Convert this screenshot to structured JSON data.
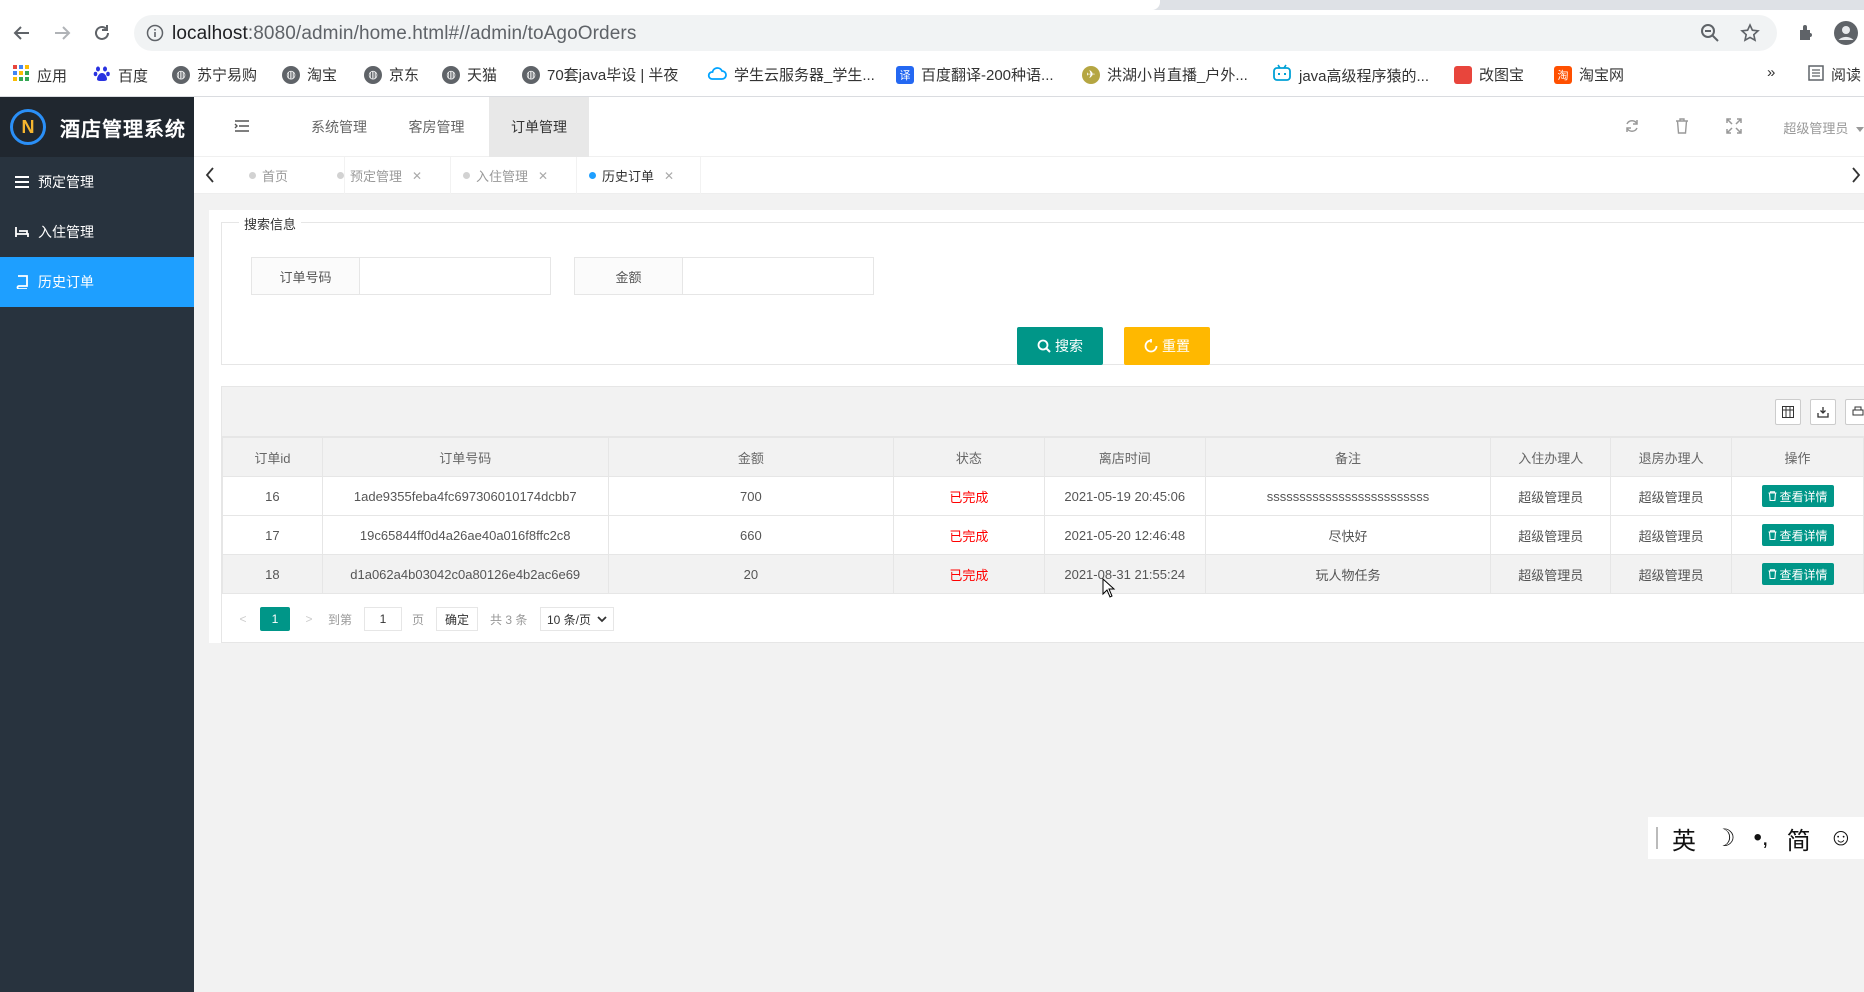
{
  "browser": {
    "url_host": "localhost",
    "url_path": ":8080/admin/home.html#//admin/toAgoOrders",
    "bookmarks": [
      {
        "label": "应用",
        "icon": "apps-grid-icon",
        "color": "#4285f4"
      },
      {
        "label": "百度",
        "icon": "baidu-paw-icon",
        "color": "#2932e1"
      },
      {
        "label": "苏宁易购",
        "icon": "globe-icon",
        "color": "#5f6368"
      },
      {
        "label": "淘宝",
        "icon": "globe-icon",
        "color": "#5f6368"
      },
      {
        "label": "京东",
        "icon": "globe-icon",
        "color": "#5f6368"
      },
      {
        "label": "天猫",
        "icon": "globe-icon",
        "color": "#5f6368"
      },
      {
        "label": "70套java毕设 | 半夜",
        "icon": "globe-icon",
        "color": "#5f6368"
      },
      {
        "label": "学生云服务器_学生...",
        "icon": "cloud-icon",
        "color": "#00a3ff"
      },
      {
        "label": "百度翻译-200种语...",
        "icon": "translate-icon",
        "color": "#2468f2"
      },
      {
        "label": "洪湖小肖直播_户外...",
        "icon": "bird-icon",
        "color": "#b5a642"
      },
      {
        "label": "java高级程序猿的...",
        "icon": "bilibili-icon",
        "color": "#00a1d6"
      },
      {
        "label": "改图宝",
        "icon": "square-icon",
        "color": "#e8453c"
      },
      {
        "label": "淘宝网",
        "icon": "taobao-icon",
        "color": "#ff5000"
      }
    ],
    "more_label": "»",
    "reading_list_label": "阅读"
  },
  "sidebar": {
    "title": "酒店管理系统",
    "items": [
      {
        "label": "预定管理",
        "icon": "list-icon"
      },
      {
        "label": "入住管理",
        "icon": "bed-icon"
      },
      {
        "label": "历史订单",
        "icon": "book-icon"
      }
    ]
  },
  "header": {
    "tabs": [
      {
        "label": "系统管理"
      },
      {
        "label": "客房管理"
      },
      {
        "label": "订单管理"
      }
    ],
    "user_label": "超级管理员"
  },
  "page_tabs": [
    {
      "label": "首页"
    },
    {
      "label": "预定管理"
    },
    {
      "label": "入住管理"
    },
    {
      "label": "历史订单"
    }
  ],
  "search": {
    "legend": "搜索信息",
    "order_no_label": "订单号码",
    "order_no_value": "",
    "amount_label": "金额",
    "amount_value": "",
    "search_button": "搜索",
    "reset_button": "重置"
  },
  "table": {
    "columns": [
      "订单id",
      "订单号码",
      "金额",
      "状态",
      "离店时间",
      "备注",
      "入住办理人",
      "退房办理人",
      "操作"
    ],
    "rows": [
      {
        "id": "16",
        "order_no": "1ade9355feba4fc697306010174dcbb7",
        "amount": "700",
        "status": "已完成",
        "checkout": "2021-05-19 20:45:06",
        "note": "sssssssssssssssssssssssss",
        "checkin_by": "超级管理员",
        "checkout_by": "超级管理员",
        "action": "查看详情"
      },
      {
        "id": "17",
        "order_no": "19c65844ff0d4a26ae40a016f8ffc2c8",
        "amount": "660",
        "status": "已完成",
        "checkout": "2021-05-20 12:46:48",
        "note": "尽快好",
        "checkin_by": "超级管理员",
        "checkout_by": "超级管理员",
        "action": "查看详情"
      },
      {
        "id": "18",
        "order_no": "d1a062a4b03042c0a80126e4b2ac6e69",
        "amount": "20",
        "status": "已完成",
        "checkout": "2021-08-31 21:55:24",
        "note": "玩人物任务",
        "checkin_by": "超级管理员",
        "checkout_by": "超级管理员",
        "action": "查看详情"
      }
    ]
  },
  "pager": {
    "prev": "<",
    "current_page": "1",
    "next": ">",
    "goto_label": "到第",
    "goto_value": "1",
    "page_unit": "页",
    "confirm": "确定",
    "total": "共 3 条",
    "page_size": "10 条/页"
  },
  "ime": {
    "lang": "英",
    "moon": "☽",
    "punct": "•,",
    "simp": "简",
    "emoji": "☺"
  },
  "colors": {
    "sidebar_bg": "#28333e",
    "active_blue": "#1e9fff",
    "teal": "#009688",
    "amber": "#ffb800",
    "status_red": "#ff0000"
  }
}
